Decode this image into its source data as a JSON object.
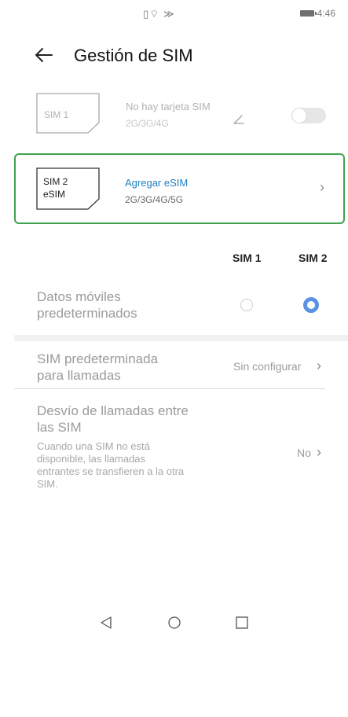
{
  "status_bar": {
    "icons_text": "▯⌔ ≫",
    "time": "4:46"
  },
  "header": {
    "title": "Gestión de SIM"
  },
  "sim1": {
    "card_label": "SIM 1",
    "status": "No hay tarjeta SIM",
    "bands": "2G/3G/4G"
  },
  "sim2": {
    "card_label_line1": "SIM 2",
    "card_label_line2": "eSIM",
    "status": "Agregar eSIM",
    "bands": "2G/3G/4G/5G",
    "status_color": "#1f7fc2"
  },
  "columns": {
    "sim1": "SIM 1",
    "sim2": "SIM 2"
  },
  "default_data": {
    "label_line1": "Datos móviles",
    "label_line2": "predeterminados"
  },
  "default_calls": {
    "label_line1": "SIM predeterminada",
    "label_line2": "para llamadas",
    "value": "Sin configurar"
  },
  "call_forwarding": {
    "label_line1": "Desvío de llamadas entre",
    "label_line2": "las SIM",
    "desc_line1": "Cuando una SIM no está",
    "desc_line2": "disponible, las llamadas",
    "desc_line3": "entrantes se transfieren a la otra",
    "desc_line4": "SIM.",
    "value": "No"
  },
  "colors": {
    "highlight_border": "#3fa34d",
    "radio_selected": "#5b93e4"
  }
}
